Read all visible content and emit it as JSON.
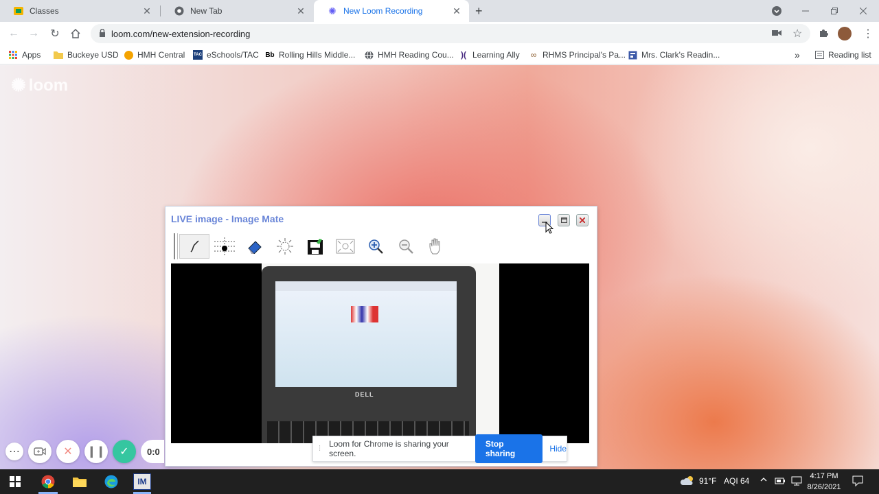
{
  "tabs": [
    {
      "title": "Classes",
      "icon": "google-classroom-icon",
      "close": "✕"
    },
    {
      "title": "New Tab",
      "icon": "chrome-icon",
      "close": "✕"
    },
    {
      "title": "New Loom Recording",
      "icon": "loom-icon",
      "close": "✕"
    }
  ],
  "new_tab": "+",
  "address_bar": {
    "url": "loom.com/new-extension-recording"
  },
  "bookmarks": [
    {
      "label": "Apps",
      "icon": "apps-grid-icon"
    },
    {
      "label": "Buckeye USD",
      "icon": "folder-icon"
    },
    {
      "label": "HMH Central",
      "icon": "hmh-icon"
    },
    {
      "label": "eSchools/TAC",
      "icon": "tac-icon",
      "badge": "TAC"
    },
    {
      "label": "Rolling Hills Middle...",
      "icon": "blackboard-icon",
      "badge": "Bb"
    },
    {
      "label": "HMH Reading Cou...",
      "icon": "globe-icon"
    },
    {
      "label": "Learning Ally",
      "icon": "learning-ally-icon"
    },
    {
      "label": "RHMS Principal's Pa...",
      "icon": "link-icon"
    },
    {
      "label": "Mrs. Clark's Readin...",
      "icon": "page-icon"
    }
  ],
  "bookmarks_more": "»",
  "reading_list": "Reading list",
  "loom_logo": "loom",
  "image_mate": {
    "title": "LIVE image - Image Mate",
    "tools": [
      "pen-icon",
      "grid-icon",
      "eraser-icon",
      "brightness-icon",
      "save-icon",
      "fit-icon",
      "zoom-in-icon",
      "zoom-out-icon",
      "hand-icon"
    ],
    "laptop_brand": "DELL"
  },
  "recorder": {
    "timer": "0:0"
  },
  "share_banner": {
    "message": "Loom for Chrome is sharing your screen.",
    "stop": "Stop sharing",
    "hide": "Hide"
  },
  "taskbar": {
    "app_label": "IM",
    "weather": "91°F",
    "aqi": "AQI 64",
    "time": "4:17 PM",
    "date": "8/26/2021"
  },
  "colors": {
    "accent": "#1a73e8",
    "loom_check": "#35c6a0",
    "image_mate_title": "#6a86d8"
  }
}
